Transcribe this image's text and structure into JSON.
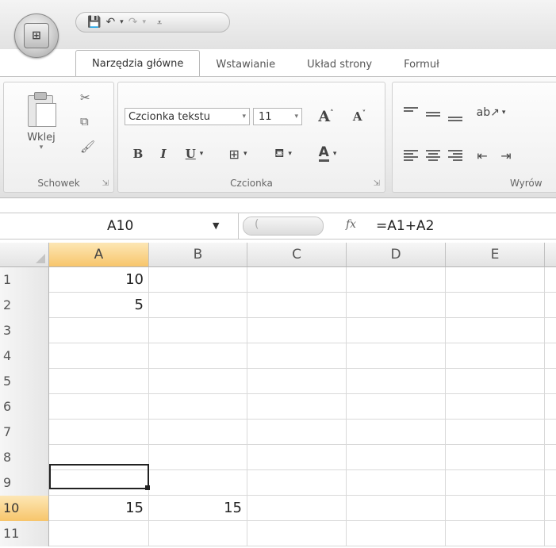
{
  "ribbon": {
    "tabs": [
      {
        "label": "Narzędzia główne",
        "active": true
      },
      {
        "label": "Wstawianie",
        "active": false
      },
      {
        "label": "Układ strony",
        "active": false
      },
      {
        "label": "Formuł",
        "active": false
      }
    ],
    "groups": {
      "clipboard": {
        "label": "Schowek",
        "paste_label": "Wklej"
      },
      "font": {
        "label": "Czcionka",
        "font_name": "Czcionka tekstu",
        "font_size": "11"
      },
      "alignment": {
        "label": "Wyrów"
      }
    }
  },
  "formula_bar": {
    "name_box": "A10",
    "fx_label": "fx",
    "formula": "=A1+A2"
  },
  "sheet": {
    "columns": [
      "A",
      "B",
      "C",
      "D",
      "E"
    ],
    "selected_column": "A",
    "rows": [
      {
        "label": "1",
        "cells": [
          "10",
          "",
          "",
          "",
          ""
        ]
      },
      {
        "label": "2",
        "cells": [
          "5",
          "",
          "",
          "",
          ""
        ]
      },
      {
        "label": "3",
        "cells": [
          "",
          "",
          "",
          "",
          ""
        ]
      },
      {
        "label": "4",
        "cells": [
          "",
          "",
          "",
          "",
          ""
        ]
      },
      {
        "label": "5",
        "cells": [
          "",
          "",
          "",
          "",
          ""
        ]
      },
      {
        "label": "6",
        "cells": [
          "",
          "",
          "",
          "",
          ""
        ]
      },
      {
        "label": "7",
        "cells": [
          "",
          "",
          "",
          "",
          ""
        ]
      },
      {
        "label": "8",
        "cells": [
          "",
          "",
          "",
          "",
          ""
        ]
      },
      {
        "label": "9",
        "cells": [
          "",
          "",
          "",
          "",
          ""
        ]
      },
      {
        "label": "10",
        "cells": [
          "15",
          "15",
          "",
          "",
          ""
        ]
      },
      {
        "label": "11",
        "cells": [
          "",
          "",
          "",
          "",
          ""
        ]
      }
    ],
    "selected_row": "10",
    "active_cell": "A10"
  }
}
